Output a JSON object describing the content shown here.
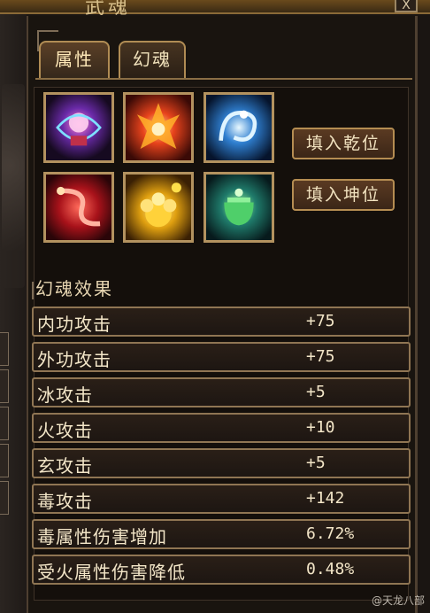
{
  "window": {
    "title": "武魂",
    "close_label": "X"
  },
  "tabs": [
    {
      "label": "属性",
      "active": true
    },
    {
      "label": "幻魂",
      "active": false
    }
  ],
  "slots": [
    {
      "icon": "gem-crest-icon"
    },
    {
      "icon": "flame-crystal-icon"
    },
    {
      "icon": "ice-dragon-icon"
    },
    {
      "icon": "red-serpent-icon"
    },
    {
      "icon": "golden-flower-icon"
    },
    {
      "icon": "jade-cauldron-icon"
    }
  ],
  "buttons": {
    "fill_qian": "填入乾位",
    "fill_kun": "填入坤位"
  },
  "effects": {
    "title": "幻魂效果",
    "rows": [
      {
        "name": "内功攻击",
        "value": "+75"
      },
      {
        "name": "外功攻击",
        "value": "+75"
      },
      {
        "name": "冰攻击",
        "value": "+5"
      },
      {
        "name": "火攻击",
        "value": "+10"
      },
      {
        "name": "玄攻击",
        "value": "+5"
      },
      {
        "name": "毒攻击",
        "value": "+142"
      },
      {
        "name": "毒属性伤害增加",
        "value": "6.72%"
      },
      {
        "name": "受火属性伤害降低",
        "value": "0.48%"
      }
    ]
  },
  "watermark": "@天龙八部",
  "colors": {
    "frame_gold": "#b3925f",
    "text": "#f3e6c8"
  }
}
